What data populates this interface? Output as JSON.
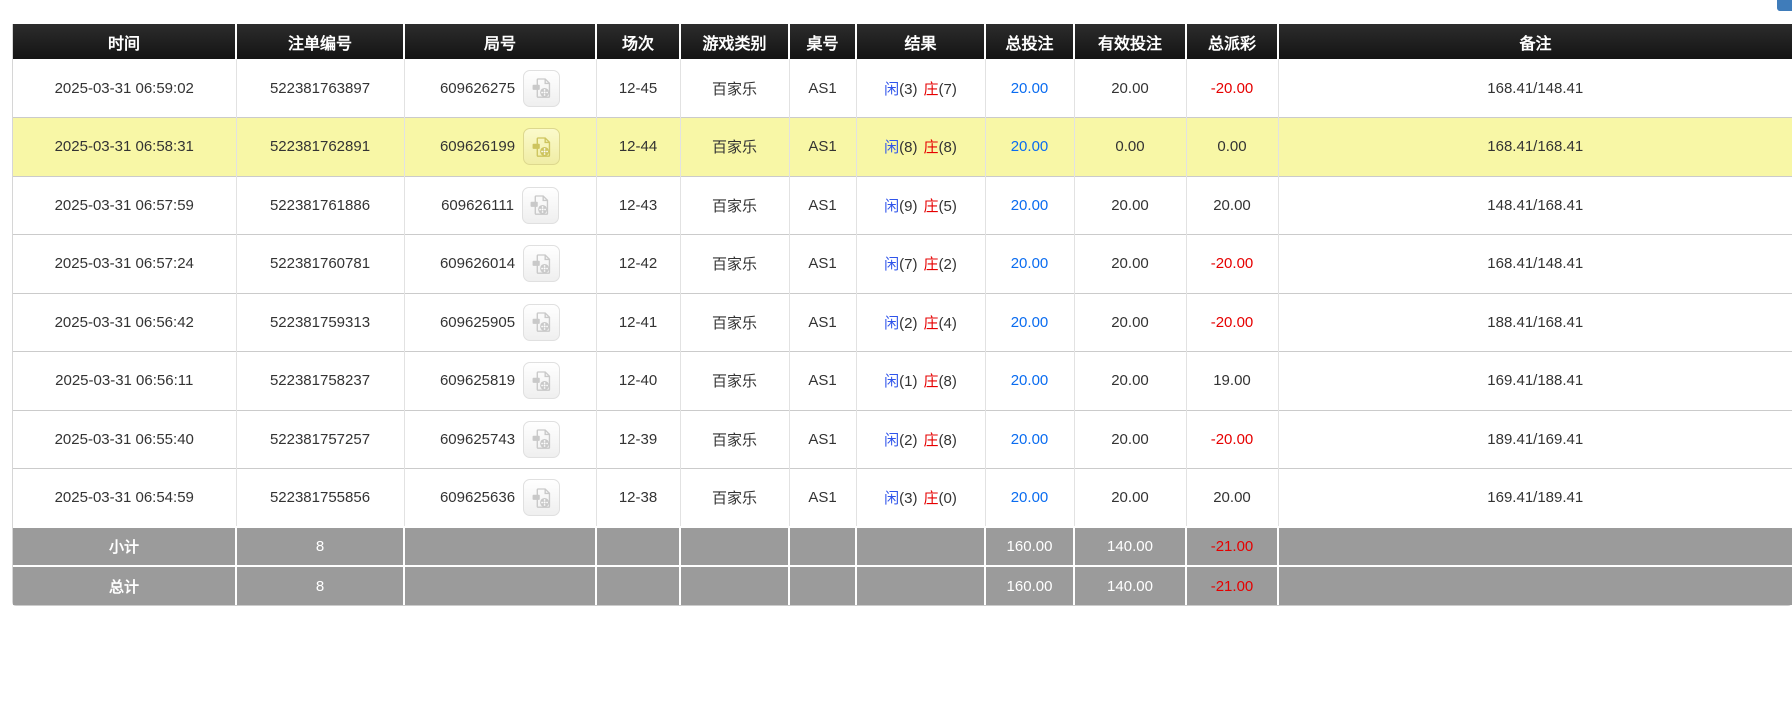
{
  "colors": {
    "header_bg": "#1e1e1e",
    "header_text": "#ffffff",
    "row_highlight_bg": "#f8f7a6",
    "summary_bg": "#9b9b9b",
    "amount_blue": "#0a6cf0",
    "player_blue": "#2f54eb",
    "banker_red": "#e60000",
    "negative_red": "#e60000",
    "border_gray": "#d9d9d9",
    "text_dark": "#333333",
    "corner_button_blue": "#3f7cba"
  },
  "table": {
    "headers": [
      "时间",
      "注单编号",
      "局号",
      "场次",
      "游戏类别",
      "桌号",
      "结果",
      "总投注",
      "有效投注",
      "总派彩",
      "备注"
    ],
    "video_icon_name": "video-replay-icon",
    "rows": [
      {
        "time": "2025-03-31 06:59:02",
        "bet_id": "522381763897",
        "round_no": "609626275",
        "session": "12-45",
        "game_type": "百家乐",
        "table_no": "AS1",
        "result_player": "闲",
        "result_player_n": "(3)",
        "result_banker": "庄",
        "result_banker_n": "(7)",
        "total_bet": "20.00",
        "valid_bet": "20.00",
        "payout": "-20.00",
        "payout_class": "neg",
        "remark": "168.41/148.41",
        "row_class": ""
      },
      {
        "time": "2025-03-31 06:58:31",
        "bet_id": "522381762891",
        "round_no": "609626199",
        "session": "12-44",
        "game_type": "百家乐",
        "table_no": "AS1",
        "result_player": "闲",
        "result_player_n": "(8)",
        "result_banker": "庄",
        "result_banker_n": "(8)",
        "total_bet": "20.00",
        "valid_bet": "0.00",
        "payout": "0.00",
        "payout_class": "",
        "remark": "168.41/168.41",
        "row_class": "highlight"
      },
      {
        "time": "2025-03-31 06:57:59",
        "bet_id": "522381761886",
        "round_no": "609626111",
        "session": "12-43",
        "game_type": "百家乐",
        "table_no": "AS1",
        "result_player": "闲",
        "result_player_n": "(9)",
        "result_banker": "庄",
        "result_banker_n": "(5)",
        "total_bet": "20.00",
        "valid_bet": "20.00",
        "payout": "20.00",
        "payout_class": "",
        "remark": "148.41/168.41",
        "row_class": ""
      },
      {
        "time": "2025-03-31 06:57:24",
        "bet_id": "522381760781",
        "round_no": "609626014",
        "session": "12-42",
        "game_type": "百家乐",
        "table_no": "AS1",
        "result_player": "闲",
        "result_player_n": "(7)",
        "result_banker": "庄",
        "result_banker_n": "(2)",
        "total_bet": "20.00",
        "valid_bet": "20.00",
        "payout": "-20.00",
        "payout_class": "neg",
        "remark": "168.41/148.41",
        "row_class": ""
      },
      {
        "time": "2025-03-31 06:56:42",
        "bet_id": "522381759313",
        "round_no": "609625905",
        "session": "12-41",
        "game_type": "百家乐",
        "table_no": "AS1",
        "result_player": "闲",
        "result_player_n": "(2)",
        "result_banker": "庄",
        "result_banker_n": "(4)",
        "total_bet": "20.00",
        "valid_bet": "20.00",
        "payout": "-20.00",
        "payout_class": "neg",
        "remark": "188.41/168.41",
        "row_class": ""
      },
      {
        "time": "2025-03-31 06:56:11",
        "bet_id": "522381758237",
        "round_no": "609625819",
        "session": "12-40",
        "game_type": "百家乐",
        "table_no": "AS1",
        "result_player": "闲",
        "result_player_n": "(1)",
        "result_banker": "庄",
        "result_banker_n": "(8)",
        "total_bet": "20.00",
        "valid_bet": "20.00",
        "payout": "19.00",
        "payout_class": "",
        "remark": "169.41/188.41",
        "row_class": ""
      },
      {
        "time": "2025-03-31 06:55:40",
        "bet_id": "522381757257",
        "round_no": "609625743",
        "session": "12-39",
        "game_type": "百家乐",
        "table_no": "AS1",
        "result_player": "闲",
        "result_player_n": "(2)",
        "result_banker": "庄",
        "result_banker_n": "(8)",
        "total_bet": "20.00",
        "valid_bet": "20.00",
        "payout": "-20.00",
        "payout_class": "neg",
        "remark": "189.41/169.41",
        "row_class": ""
      },
      {
        "time": "2025-03-31 06:54:59",
        "bet_id": "522381755856",
        "round_no": "609625636",
        "session": "12-38",
        "game_type": "百家乐",
        "table_no": "AS1",
        "result_player": "闲",
        "result_player_n": "(3)",
        "result_banker": "庄",
        "result_banker_n": "(0)",
        "total_bet": "20.00",
        "valid_bet": "20.00",
        "payout": "20.00",
        "payout_class": "",
        "remark": "169.41/189.41",
        "row_class": ""
      }
    ],
    "subtotal": {
      "label": "小计",
      "count": "8",
      "total_bet": "160.00",
      "valid_bet": "140.00",
      "payout": "-21.00",
      "payout_class": "neg"
    },
    "grand_total": {
      "label": "总计",
      "count": "8",
      "total_bet": "160.00",
      "valid_bet": "140.00",
      "payout": "-21.00",
      "payout_class": "neg"
    }
  }
}
